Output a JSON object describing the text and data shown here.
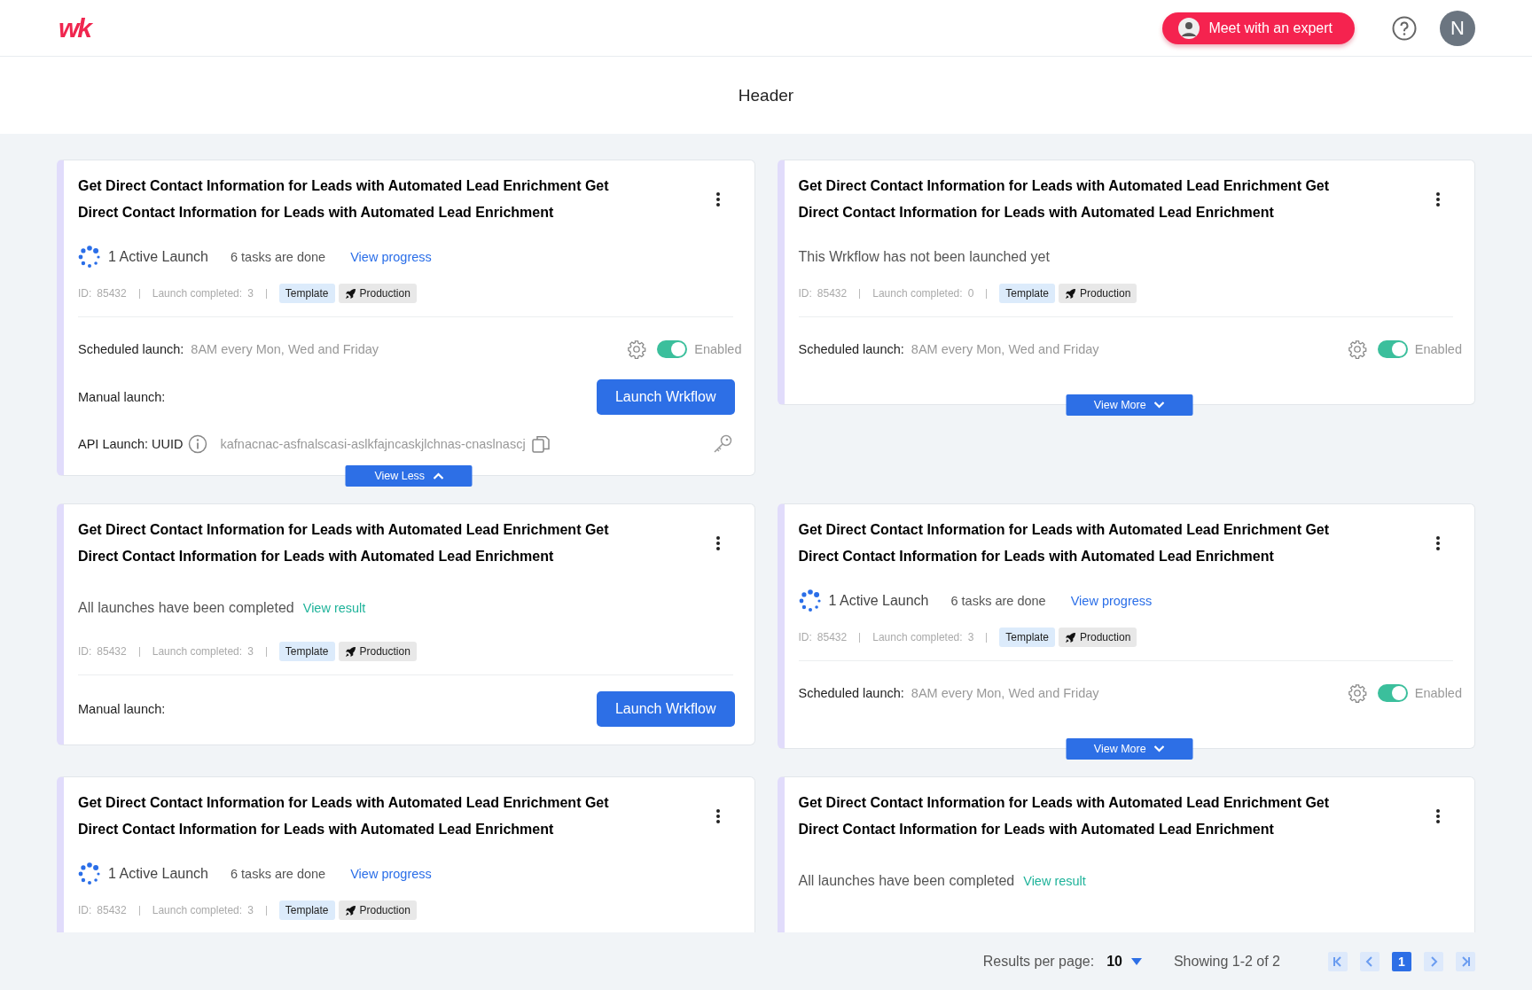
{
  "topbar": {
    "logo": "wk",
    "expert_button": "Meet with an expert",
    "user_initial": "N"
  },
  "header": {
    "title": "Header"
  },
  "cards": [
    {
      "title": "Get Direct Contact Information for Leads with Automated Lead Enrichment Get Direct Contact Information for Leads with Automated Lead Enrichment",
      "expanded": true,
      "status": {
        "kind": "active",
        "text": "1 Active Launch",
        "tasks": "6 tasks are done",
        "link": "View progress"
      },
      "meta": {
        "id_label": "ID:",
        "id": "85432",
        "completed_label": "Launch completed:",
        "completed": "3"
      },
      "tags": [
        {
          "kind": "template",
          "label": "Template"
        },
        {
          "kind": "production",
          "label": "Production"
        }
      ],
      "scheduled": {
        "label": "Scheduled launch:",
        "value": "8AM every Mon, Wed and Friday",
        "on": true,
        "state_label": "Enabled"
      },
      "manual": {
        "label": "Manual launch:",
        "button": "Launch Wrkflow"
      },
      "api": {
        "label": "API Launch: UUID",
        "uuid": "kafnacnac-asfnalscasi-aslkfajncaskjlchnas-cnaslnascj"
      },
      "view_toggle": "View Less"
    },
    {
      "title": "Get Direct Contact Information for Leads with Automated Lead Enrichment Get Direct Contact Information for Leads with Automated Lead Enrichment",
      "expanded": false,
      "status": {
        "kind": "not_launched",
        "text": "This Wrkflow has not been launched yet"
      },
      "meta": {
        "id_label": "ID:",
        "id": "85432",
        "completed_label": "Launch completed:",
        "completed": "0"
      },
      "tags": [
        {
          "kind": "template",
          "label": "Template"
        },
        {
          "kind": "production",
          "label": "Production"
        }
      ],
      "scheduled": {
        "label": "Scheduled launch:",
        "value": "8AM every Mon, Wed and Friday",
        "on": true,
        "state_label": "Enabled"
      },
      "view_toggle": "View More"
    },
    {
      "title": "Get Direct Contact Information for Leads with Automated Lead Enrichment Get Direct Contact Information for Leads with Automated Lead Enrichment",
      "status": {
        "kind": "completed",
        "text": "All launches have been completed",
        "link": "View result"
      },
      "meta": {
        "id_label": "ID:",
        "id": "85432",
        "completed_label": "Launch completed:",
        "completed": "3"
      },
      "tags": [
        {
          "kind": "template",
          "label": "Template"
        },
        {
          "kind": "production",
          "label": "Production"
        }
      ],
      "manual": {
        "label": "Manual launch:",
        "button": "Launch Wrkflow"
      }
    },
    {
      "title": "Get Direct Contact Information for Leads with Automated Lead Enrichment Get Direct Contact Information for Leads with Automated Lead Enrichment",
      "expanded": false,
      "status": {
        "kind": "active",
        "text": "1 Active Launch",
        "tasks": "6 tasks are done",
        "link": "View progress"
      },
      "meta": {
        "id_label": "ID:",
        "id": "85432",
        "completed_label": "Launch completed:",
        "completed": "3"
      },
      "tags": [
        {
          "kind": "template",
          "label": "Template"
        },
        {
          "kind": "production",
          "label": "Production"
        }
      ],
      "scheduled": {
        "label": "Scheduled launch:",
        "value": "8AM every Mon, Wed and Friday",
        "on": true,
        "state_label": "Enabled"
      },
      "view_toggle": "View More"
    },
    {
      "title": "Get Direct Contact Information for Leads with Automated Lead Enrichment Get Direct Contact Information for Leads with Automated Lead Enrichment",
      "status": {
        "kind": "active",
        "text": "1 Active Launch",
        "tasks": "6 tasks are done",
        "link": "View progress"
      },
      "meta": {
        "id_label": "ID:",
        "id": "85432",
        "completed_label": "Launch completed:",
        "completed": "3"
      },
      "tags": [
        {
          "kind": "template",
          "label": "Template"
        },
        {
          "kind": "production",
          "label": "Production"
        }
      ]
    },
    {
      "title": "Get Direct Contact Information for Leads with Automated Lead Enrichment Get Direct Contact Information for Leads with Automated Lead Enrichment",
      "status": {
        "kind": "completed",
        "text": "All launches have been completed",
        "link": "View result"
      }
    }
  ],
  "footer": {
    "per_page_label": "Results per page:",
    "per_page": "10",
    "showing": "Showing 1-2 of 2",
    "pages": [
      {
        "label": "1",
        "selected": true
      }
    ]
  }
}
